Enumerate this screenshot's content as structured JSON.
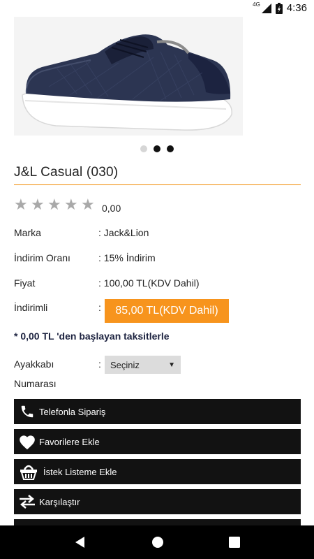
{
  "status_bar": {
    "time": "4:36",
    "network": "4G"
  },
  "carousel": {
    "dots": [
      "inactive",
      "active",
      "active"
    ]
  },
  "product": {
    "title": "J&L Casual (030)",
    "rating": {
      "stars": 0,
      "max": 5,
      "value": "0,00"
    }
  },
  "details": {
    "brand_label": "Marka",
    "brand_value": ": Jack&Lion",
    "discount_label": "İndirim Oranı",
    "discount_value": ": 15% İndirim",
    "price_label": "Fiyat",
    "price_value": ": 100,00 TL(KDV Dahil)",
    "discounted_label": "İndirimli",
    "discounted_sep": ":",
    "discounted_value": "85,00 TL(KDV Dahil)"
  },
  "installments_text": "* 0,00 TL 'den başlayan taksitlerle",
  "shoe_size": {
    "label_line1": "Ayakkabı",
    "label_line2": "Numarası",
    "sep": ":",
    "selected": "Seçiniz"
  },
  "actions": [
    {
      "label": "Telefonla Sipariş",
      "icon": "phone-icon"
    },
    {
      "label": "Favorilere Ekle",
      "icon": "heart-icon"
    },
    {
      "label": "İstek Listeme Ekle",
      "icon": "basket-icon"
    },
    {
      "label": "Karşılaştır",
      "icon": "compare-arrows-icon"
    }
  ],
  "colors": {
    "accent": "#f7941d",
    "rule": "#f08a00",
    "button_bg": "#121212",
    "installments_text": "#1d2340"
  }
}
